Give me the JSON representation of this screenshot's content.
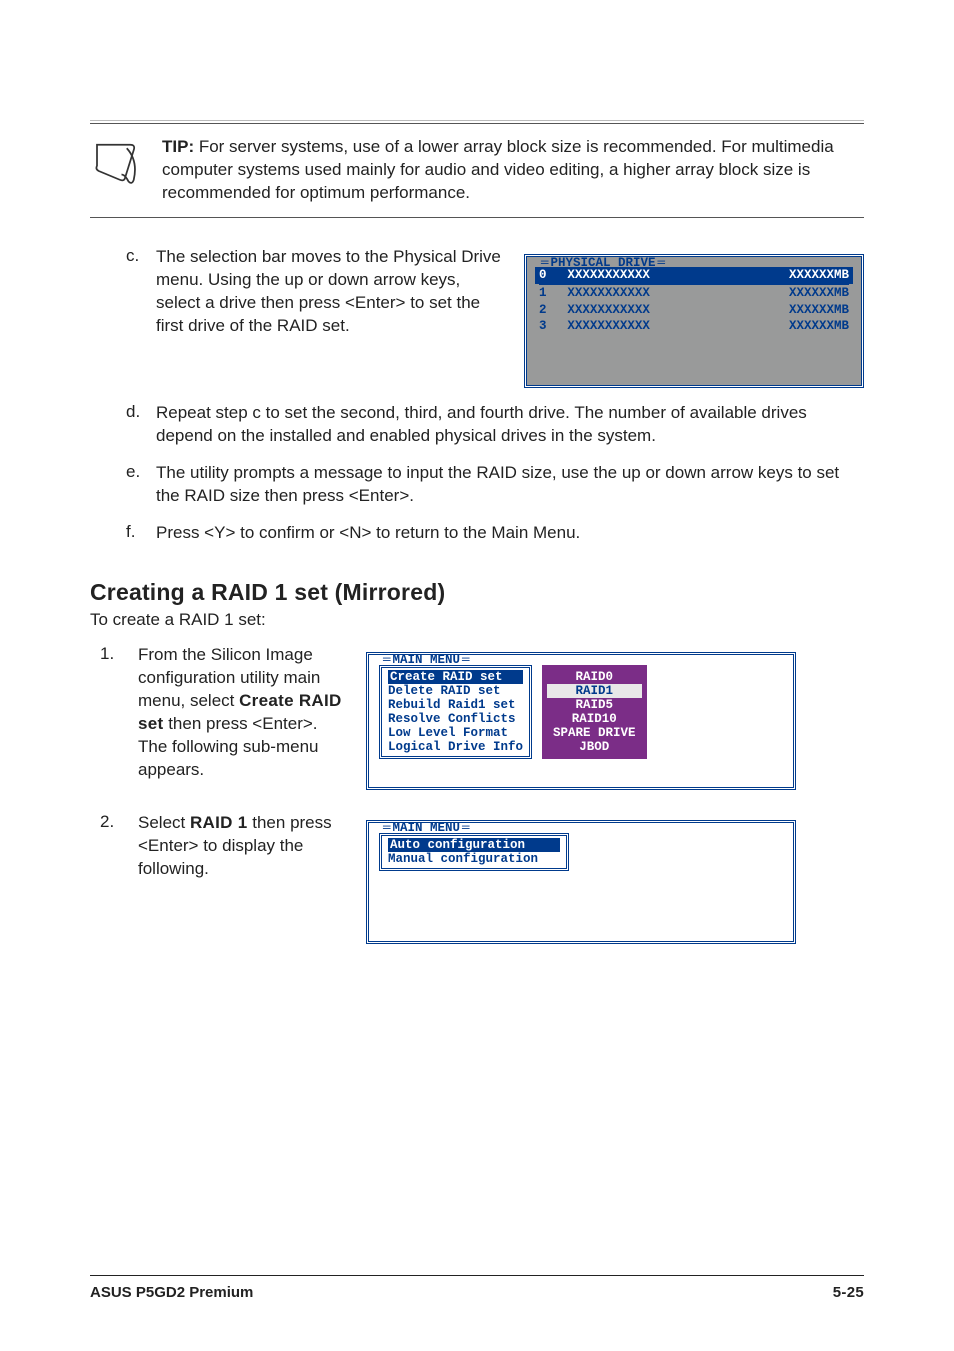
{
  "tip": {
    "label": "TIP:",
    "text": " For server systems, use of a lower array block size is recommended. For multimedia computer systems used mainly for audio and video editing, a higher array block size is recommended for optimum performance."
  },
  "step_c": {
    "bullet": "c.",
    "text": "The selection bar moves to the Physical Drive menu. Using the up or down arrow keys, select a drive then press <Enter> to set the first drive of the RAID set."
  },
  "phys_panel": {
    "title": "PHYSICAL DRIVE",
    "rows": [
      {
        "idx": "0",
        "name": "XXXXXXXXXXX",
        "size": "XXXXXXMB"
      },
      {
        "idx": "1",
        "name": "XXXXXXXXXXX",
        "size": "XXXXXXMB"
      },
      {
        "idx": "2",
        "name": "XXXXXXXXXXX",
        "size": "XXXXXXMB"
      },
      {
        "idx": "3",
        "name": "XXXXXXXXXXX",
        "size": "XXXXXXMB"
      }
    ]
  },
  "step_d": {
    "bullet": "d.",
    "text": "Repeat step c to set the second, third, and fourth drive. The number of available drives depend on the installed and enabled physical drives in the system."
  },
  "step_e": {
    "bullet": "e.",
    "text": "The utility prompts a message to input the RAID size, use the up or down arrow keys to set the RAID size then press <Enter>."
  },
  "step_f": {
    "bullet": "f.",
    "text": "Press <Y> to confirm or <N> to return to the Main Menu."
  },
  "section": {
    "heading": "Creating a RAID 1 set (Mirrored)",
    "sub": "To create a RAID 1 set:"
  },
  "nstep1": {
    "num": "1.",
    "pre": "From the Silicon Image configuration utility main menu, select ",
    "bold": "Create RAID set",
    "post": " then press <Enter>. The following sub-menu appears."
  },
  "main_panel": {
    "title": "MAIN MENU",
    "left": [
      {
        "label": "Create RAID set",
        "sel": true
      },
      {
        "label": "Delete RAID set",
        "sel": false
      },
      {
        "label": "Rebuild Raid1 set",
        "sel": false
      },
      {
        "label": "Resolve Conflicts",
        "sel": false
      },
      {
        "label": "Low Level Format",
        "sel": false
      },
      {
        "label": "Logical Drive Info",
        "sel": false
      }
    ],
    "right": [
      {
        "label": "RAID0",
        "white": false
      },
      {
        "label": "RAID1",
        "white": true
      },
      {
        "label": "RAID5",
        "white": false
      },
      {
        "label": "RAID10",
        "white": false
      },
      {
        "label": "SPARE DRIVE",
        "white": false
      },
      {
        "label": "JBOD",
        "white": false
      }
    ]
  },
  "nstep2": {
    "num": "2.",
    "pre": "Select ",
    "bold": "RAID 1",
    "post": " then press <Enter> to display the following."
  },
  "cfg_panel": {
    "title": "MAIN MENU",
    "items": [
      {
        "label": "Auto configuration",
        "sel": true
      },
      {
        "label": "Manual configuration",
        "sel": false
      }
    ]
  },
  "footer": {
    "left": "ASUS P5GD2 Premium",
    "right": "5-25"
  }
}
